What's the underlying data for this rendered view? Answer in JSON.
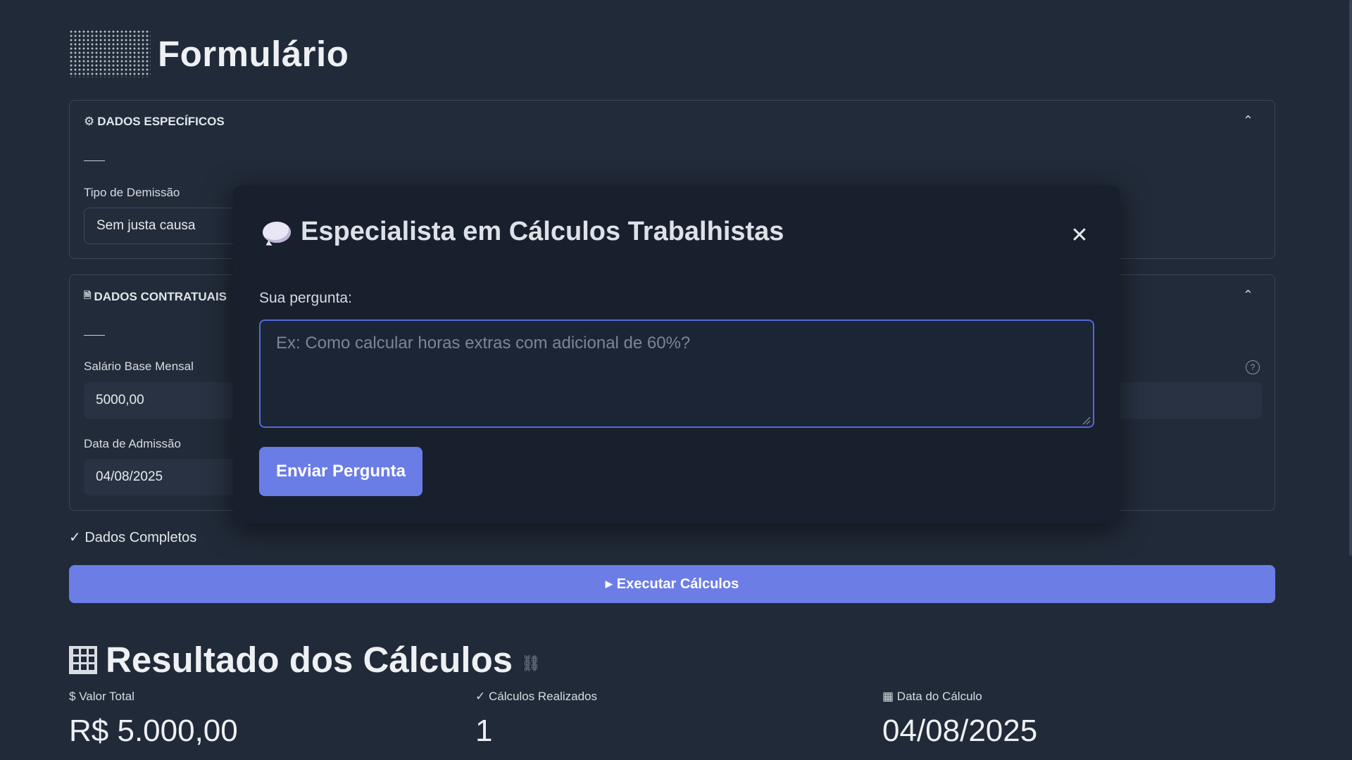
{
  "page": {
    "title": "Formulário"
  },
  "sections": {
    "specific": {
      "icon": "gear-icon",
      "title": "DADOS ESPECÍFICOS",
      "dismissal_label": "Tipo de Demissão",
      "dismissal_value": "Sem justa causa"
    },
    "contract": {
      "icon": "document-icon",
      "title": "DADOS CONTRATUAIS",
      "salary_label": "Salário Base Mensal",
      "salary_value": "5000,00",
      "admission_label": "Data de Admissão",
      "admission_value": "04/08/2025"
    }
  },
  "status": {
    "icon": "checkmark-icon",
    "text": "Dados Completos"
  },
  "execute_button": {
    "icon": "play-icon",
    "label": "Executar Cálculos"
  },
  "results": {
    "icon": "grid-icon",
    "title": "Resultado dos Cálculos",
    "metrics": [
      {
        "icon": "dollar-icon",
        "icon_glyph": "$",
        "label": "Valor Total",
        "value": "R$ 5.000,00"
      },
      {
        "icon": "checkmark-icon",
        "icon_glyph": "✓",
        "label": "Cálculos Realizados",
        "value": "1"
      },
      {
        "icon": "calendar-grid-icon",
        "icon_glyph": "▦",
        "label": "Data do Cálculo",
        "value": "04/08/2025"
      }
    ]
  },
  "dialog": {
    "icon": "speech-bubble-icon",
    "title": "Especialista em Cálculos Trabalhistas",
    "close_glyph": "✕",
    "question_label": "Sua pergunta:",
    "question_placeholder": "Ex: Como calcular horas extras com adicional de 60%?",
    "question_value": "",
    "send_label": "Enviar Pergunta"
  },
  "colors": {
    "background": "#212a38",
    "accent": "#6c7ee6",
    "dialog_bg": "#19202d",
    "input_focus": "#5668d8"
  }
}
